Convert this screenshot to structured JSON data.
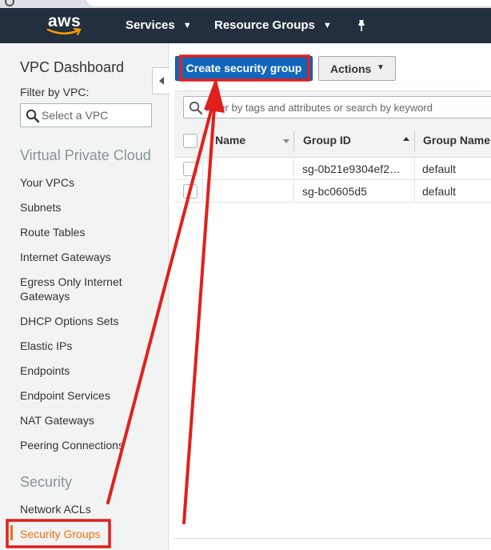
{
  "nav": {
    "logo": "aws",
    "services": "Services",
    "resource_groups": "Resource Groups"
  },
  "sidebar": {
    "title": "VPC Dashboard",
    "filter_label": "Filter by VPC:",
    "filter_placeholder": "Select a VPC",
    "sections": [
      {
        "heading": "Virtual Private Cloud",
        "items": [
          "Your VPCs",
          "Subnets",
          "Route Tables",
          "Internet Gateways",
          "Egress Only Internet Gateways",
          "DHCP Options Sets",
          "Elastic IPs",
          "Endpoints",
          "Endpoint Services",
          "NAT Gateways",
          "Peering Connections"
        ]
      },
      {
        "heading": "Security",
        "items": [
          "Network ACLs",
          "Security Groups"
        ]
      }
    ],
    "active_item": "Security Groups"
  },
  "toolbar": {
    "create_label": "Create security group",
    "actions_label": "Actions"
  },
  "search": {
    "placeholder": "Filter by tags and attributes or search by keyword"
  },
  "table": {
    "columns": [
      "Name",
      "Group ID",
      "Group Name"
    ],
    "rows": [
      {
        "name": "",
        "group_id": "sg-0b21e9304ef2…",
        "group_name": "default"
      },
      {
        "name": "",
        "group_id": "sg-bc0605d5",
        "group_name": "default"
      }
    ]
  },
  "annotation": {
    "highlight_color": "#e0201c"
  }
}
